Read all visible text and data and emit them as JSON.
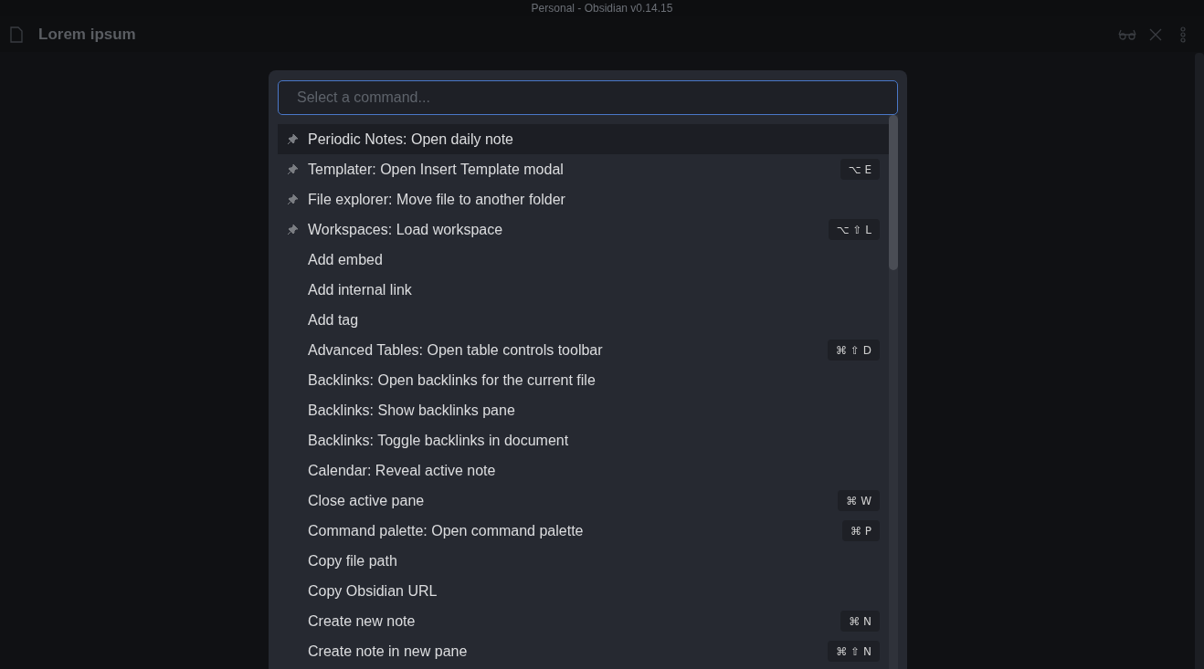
{
  "window": {
    "title": "Personal - Obsidian v0.14.15"
  },
  "tab": {
    "title": "Lorem ipsum"
  },
  "palette": {
    "placeholder": "Select a command...",
    "commands": [
      {
        "label": "Periodic Notes: Open daily note",
        "pinned": true,
        "selected": true
      },
      {
        "label": "Templater: Open Insert Template modal",
        "pinned": true,
        "selected": false,
        "hotkey": "⌥ E"
      },
      {
        "label": "File explorer: Move file to another folder",
        "pinned": true,
        "selected": false
      },
      {
        "label": "Workspaces: Load workspace",
        "pinned": true,
        "selected": false,
        "hotkey": "⌥ ⇧ L"
      },
      {
        "label": "Add embed",
        "pinned": false,
        "selected": false
      },
      {
        "label": "Add internal link",
        "pinned": false,
        "selected": false
      },
      {
        "label": "Add tag",
        "pinned": false,
        "selected": false
      },
      {
        "label": "Advanced Tables: Open table controls toolbar",
        "pinned": false,
        "selected": false,
        "hotkey": "⌘ ⇧ D"
      },
      {
        "label": "Backlinks: Open backlinks for the current file",
        "pinned": false,
        "selected": false
      },
      {
        "label": "Backlinks: Show backlinks pane",
        "pinned": false,
        "selected": false
      },
      {
        "label": "Backlinks: Toggle backlinks in document",
        "pinned": false,
        "selected": false
      },
      {
        "label": "Calendar: Reveal active note",
        "pinned": false,
        "selected": false
      },
      {
        "label": "Close active pane",
        "pinned": false,
        "selected": false,
        "hotkey": "⌘ W"
      },
      {
        "label": "Command palette: Open command palette",
        "pinned": false,
        "selected": false,
        "hotkey": "⌘ P"
      },
      {
        "label": "Copy file path",
        "pinned": false,
        "selected": false
      },
      {
        "label": "Copy Obsidian URL",
        "pinned": false,
        "selected": false
      },
      {
        "label": "Create new note",
        "pinned": false,
        "selected": false,
        "hotkey": "⌘ N"
      },
      {
        "label": "Create note in new pane",
        "pinned": false,
        "selected": false,
        "hotkey": "⌘ ⇧ N"
      }
    ]
  }
}
